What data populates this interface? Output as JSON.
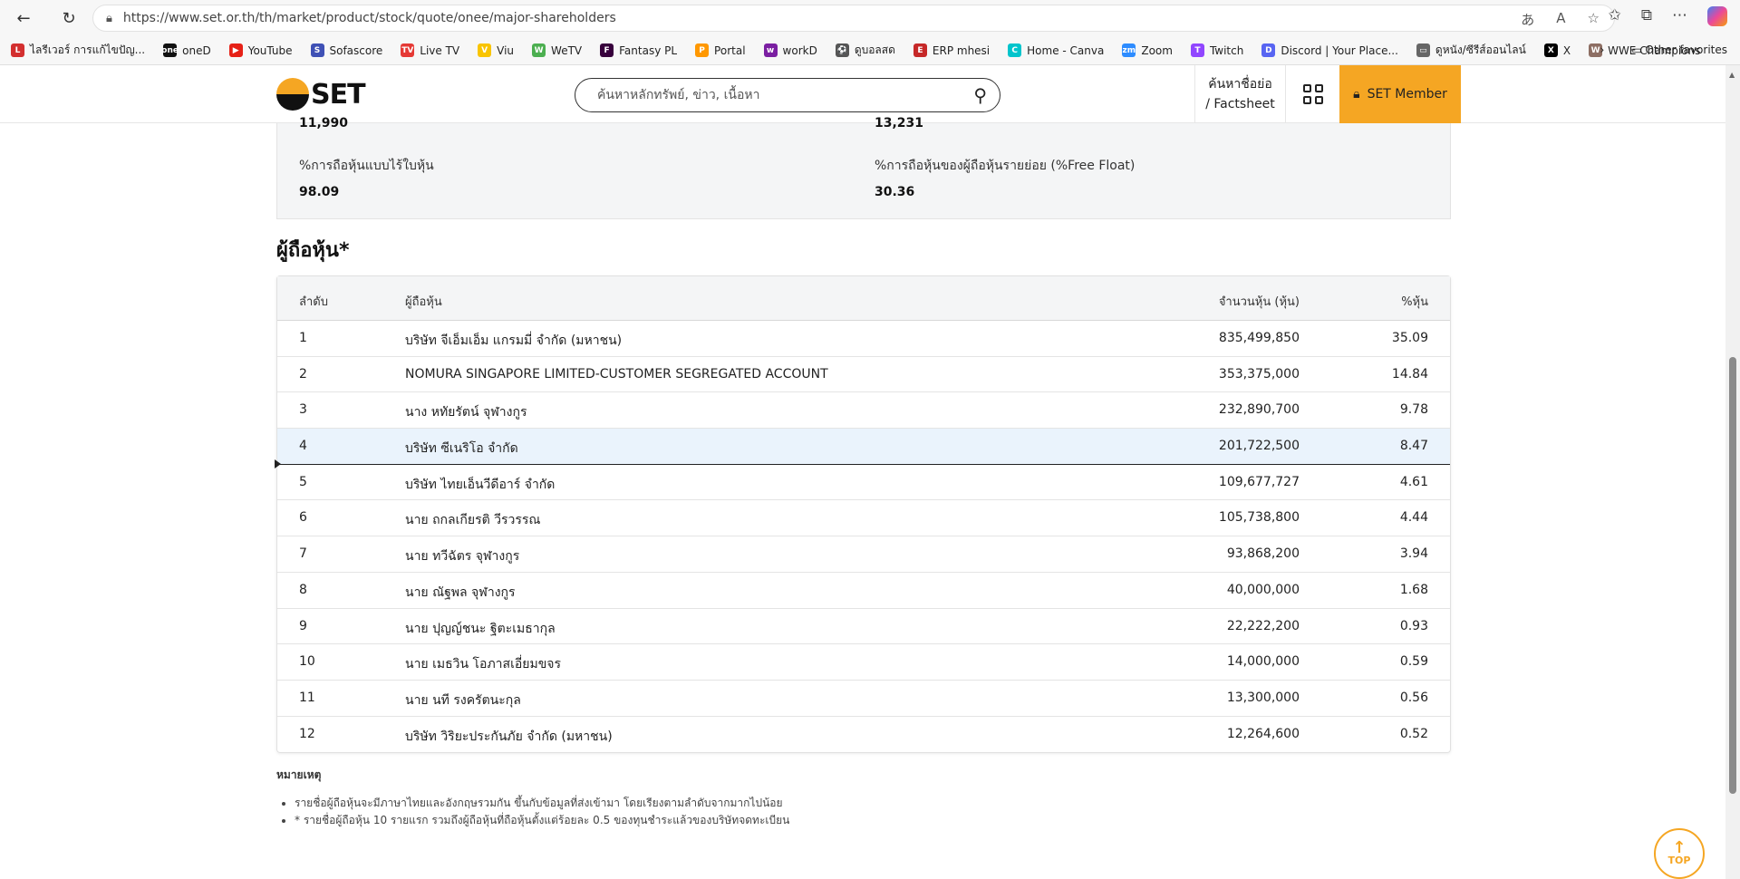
{
  "browser": {
    "url": "https://www.set.or.th/th/market/product/stock/quote/onee/major-shareholders",
    "bookmarks": [
      {
        "label": "ไลรีเวอร์ การแก้ไขปัญ...",
        "color": "#d32f2f",
        "glyph": "L"
      },
      {
        "label": "oneD",
        "color": "#111111",
        "glyph": "one"
      },
      {
        "label": "YouTube",
        "color": "#e62117",
        "glyph": "▶"
      },
      {
        "label": "Sofascore",
        "color": "#3f51b5",
        "glyph": "S"
      },
      {
        "label": "Live TV",
        "color": "#e53935",
        "glyph": "TV"
      },
      {
        "label": "Viu",
        "color": "#f9c400",
        "glyph": "V"
      },
      {
        "label": "WeTV",
        "color": "#4caf50",
        "glyph": "W"
      },
      {
        "label": "Fantasy PL",
        "color": "#37003c",
        "glyph": "F"
      },
      {
        "label": "Portal",
        "color": "#ff9800",
        "glyph": "P"
      },
      {
        "label": "workD",
        "color": "#7b1fa2",
        "glyph": "w"
      },
      {
        "label": "ดูบอลสด",
        "color": "#555555",
        "glyph": "⚽"
      },
      {
        "label": "ERP mhesi",
        "color": "#c62828",
        "glyph": "E"
      },
      {
        "label": "Home - Canva",
        "color": "#00c4cc",
        "glyph": "C"
      },
      {
        "label": "Zoom",
        "color": "#2d8cff",
        "glyph": "zm"
      },
      {
        "label": "Twitch",
        "color": "#9146ff",
        "glyph": "T"
      },
      {
        "label": "Discord | Your Place...",
        "color": "#5865f2",
        "glyph": "D"
      },
      {
        "label": "ดูหนัง/ซีรีส์ออนไลน์",
        "color": "#666666",
        "glyph": "▭"
      },
      {
        "label": "X",
        "color": "#000000",
        "glyph": "X"
      },
      {
        "label": "WWE Champions",
        "color": "#8d6e63",
        "glyph": "W"
      }
    ],
    "other_favorites": "Other favorites"
  },
  "header": {
    "logo_text": "SET",
    "search_placeholder": "ค้นหาหลักทรัพย์, ข่าว, เนื้อหา",
    "factsheet_line1": "ค้นหาชื่อย่อ",
    "factsheet_line2": "/ Factsheet",
    "member_label": "SET Member"
  },
  "stats": {
    "cut_left": "11,990",
    "cut_right": "13,231",
    "scripless_label": "%การถือหุ้นแบบไร้ใบหุ้น",
    "scripless_value": "98.09",
    "free_float_label": "%การถือหุ้นของผู้ถือหุ้นรายย่อย (%Free Float)",
    "free_float_value": "30.36"
  },
  "section_title": "ผู้ถือหุ้น*",
  "table": {
    "headers": {
      "rank": "ลำดับ",
      "name": "ผู้ถือหุ้น",
      "shares": "จำนวนหุ้น (หุ้น)",
      "pct": "%หุ้น"
    },
    "rows": [
      {
        "rank": "1",
        "name": "บริษัท จีเอ็มเอ็ม แกรมมี่ จำกัด (มหาชน)",
        "shares": "835,499,850",
        "pct": "35.09"
      },
      {
        "rank": "2",
        "name": "NOMURA SINGAPORE LIMITED-CUSTOMER SEGREGATED ACCOUNT",
        "shares": "353,375,000",
        "pct": "14.84"
      },
      {
        "rank": "3",
        "name": "นาง หทัยรัตน์ จุฬางกูร",
        "shares": "232,890,700",
        "pct": "9.78"
      },
      {
        "rank": "4",
        "name": "บริษัท ซีเนริโอ จำกัด",
        "shares": "201,722,500",
        "pct": "8.47"
      },
      {
        "rank": "5",
        "name": "บริษัท ไทยเอ็นวีดีอาร์ จำกัด",
        "shares": "109,677,727",
        "pct": "4.61"
      },
      {
        "rank": "6",
        "name": "นาย ถกลเกียรติ วีรวรรณ",
        "shares": "105,738,800",
        "pct": "4.44"
      },
      {
        "rank": "7",
        "name": "นาย ทวีฉัตร จุฬางกูร",
        "shares": "93,868,200",
        "pct": "3.94"
      },
      {
        "rank": "8",
        "name": "นาย ณัฐพล จุฬางกูร",
        "shares": "40,000,000",
        "pct": "1.68"
      },
      {
        "rank": "9",
        "name": "นาย ปุญญ์ชนะ ฐิตะเมธากุล",
        "shares": "22,222,200",
        "pct": "0.93"
      },
      {
        "rank": "10",
        "name": "นาย เมธวิน โอภาสเอี่ยมขจร",
        "shares": "14,000,000",
        "pct": "0.59"
      },
      {
        "rank": "11",
        "name": "นาย นที รงครัตนะกุล",
        "shares": "13,300,000",
        "pct": "0.56"
      },
      {
        "rank": "12",
        "name": "บริษัท วิริยะประกันภัย จำกัด (มหาชน)",
        "shares": "12,264,600",
        "pct": "0.52"
      }
    ]
  },
  "notes": {
    "title": "หมายเหตุ",
    "items": [
      "รายชื่อผู้ถือหุ้นจะมีภาษาไทยและอังกฤษรวมกัน ขึ้นกับข้อมูลที่ส่งเข้ามา โดยเรียงตามลำดับจากมากไปน้อย",
      "* รายชื่อผู้ถือหุ้น 10 รายแรก รวมถึงผู้ถือหุ้นที่ถือหุ้นตั้งแต่ร้อยละ 0.5 ของทุนชำระแล้วของบริษัทจดทะเบียน"
    ]
  },
  "top_button": "TOP",
  "colors": {
    "accent": "#f5a623",
    "highlight_row": "#eaf3fc"
  }
}
